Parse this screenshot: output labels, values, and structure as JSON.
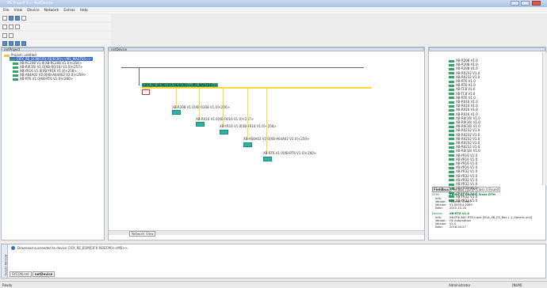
{
  "window": {
    "title": "VS Project 1 — NetDevice"
  },
  "menu": [
    "File",
    "View",
    "Device",
    "Network",
    "Extras",
    "Help"
  ],
  "project_panel": {
    "title": "netProject",
    "root": "Project: untitled",
    "items": [
      "CIFX_RE_ECM[CIFX RE/ECM]<<MS_MASTER>>",
      "XB-RC208 V1.0[XB-RC208 V1.0]<254>",
      "XB-R0(16) V1.0[XB-R0(16) V1.0]<257>",
      "XB-YR16 V1.0[XB-YR16 V1.0]<258>",
      "XB-A64A02 V2.0[XB-A64A02 V2.0]<259>",
      "XB-RT6 V1.0[XB-RT6 V1.0]<260>"
    ]
  },
  "canvas": {
    "title": "netDevice",
    "master_label": "CIFX_RE_ECM[CIFX RE/ECM]<<MS_MASTER>>",
    "devices": [
      "XB-R208 V1.0[XB-R208 V1.0]<256>",
      "XB-R016 V1.0[XB-R016 V1.0]<257>",
      "XB-YR16 V1.0[XB-YR16 V1.0]<258>",
      "XB-A64A02 V2.0[XB-A64A02 V2.0]<259>",
      "XB-RT6 V1.0[XB-RT6 V1.0]<260>"
    ],
    "tab": "Network View"
  },
  "catalog": {
    "items": [
      "XB-R208 V1.0",
      "XB-R208 V1.0",
      "XB-R208 V1.0",
      "XB-R0232 V1.0",
      "XB-R0232 V1.0",
      "XB-RT6 V1.0",
      "XB-RT6 V1.0",
      "XB-TC8 V1.0",
      "XB-TC8 V1.0",
      "XB-RT6 V1.0",
      "XB-R016 V1.0",
      "XB-R016 V1.0",
      "XB-R016 V1.0",
      "XB-R016 V1.0",
      "XB-R0(16) V1.0",
      "XB-R0(16) V1.0",
      "XB-R0(16) V1.0",
      "XB-R0232 V1.0",
      "XB-R0232 V1.0",
      "XB-R0232 V1.0",
      "XB-R0232 V1.0",
      "XB-R0232 V1.0",
      "XB-R0(16) V1.0",
      "XB-YR16 V1.0",
      "XB-YR16 V1.0",
      "XB-YR16 V1.0",
      "XB-YR16 V1.0",
      "XB-YR32 V1.0",
      "XB-YR32 V1.0",
      "XB-YR32 V1.0",
      "XB-YR32 V1.0",
      "XB-YR32 V1.0",
      "XB-YR32 V1.0",
      "XB-YR32 V1.0",
      "XB-YR32 V1.0"
    ],
    "tabs": [
      "Fieldbus",
      "Vendor",
      "DTM Class",
      "Found"
    ]
  },
  "info": {
    "dtm_label": "DTM:",
    "dtm_value": "EtherCAT Generic Slave DTM",
    "rows1": [
      [
        "Info:",
        ""
      ],
      [
        "Vendor:",
        "Hilscher GmbH"
      ],
      [
        "Version:",
        "V1.0003.4.2089"
      ],
      [
        "Date:",
        "2012-10-18"
      ]
    ],
    "device_label": "Device:",
    "device_value": "XB-RT6 V1.0",
    "rows2": [
      [
        "Info:",
        "XB-RT6 ADC RTD Input [EGA_XB_EX_Rev-1.1_Generic.xml]"
      ],
      [
        "Vendor:",
        "H2 Automation"
      ],
      [
        "Version:",
        "V1.0"
      ],
      [
        "Date:",
        "2018-04-27"
      ]
    ]
  },
  "messages": {
    "line": "Download succeeded to device CIFX_RE_ECM[CIFX RE/ECM]<<MS>>.",
    "side": "Output Window",
    "tab": "SYCON.net",
    "tab2": "netDevice"
  },
  "status": {
    "left": "Ready",
    "user": "Administrator",
    "mode": "[NUM]"
  },
  "colors": {
    "bus": "#ffd83a",
    "module": "#2db3a0",
    "device_icon": "#37a06b"
  }
}
